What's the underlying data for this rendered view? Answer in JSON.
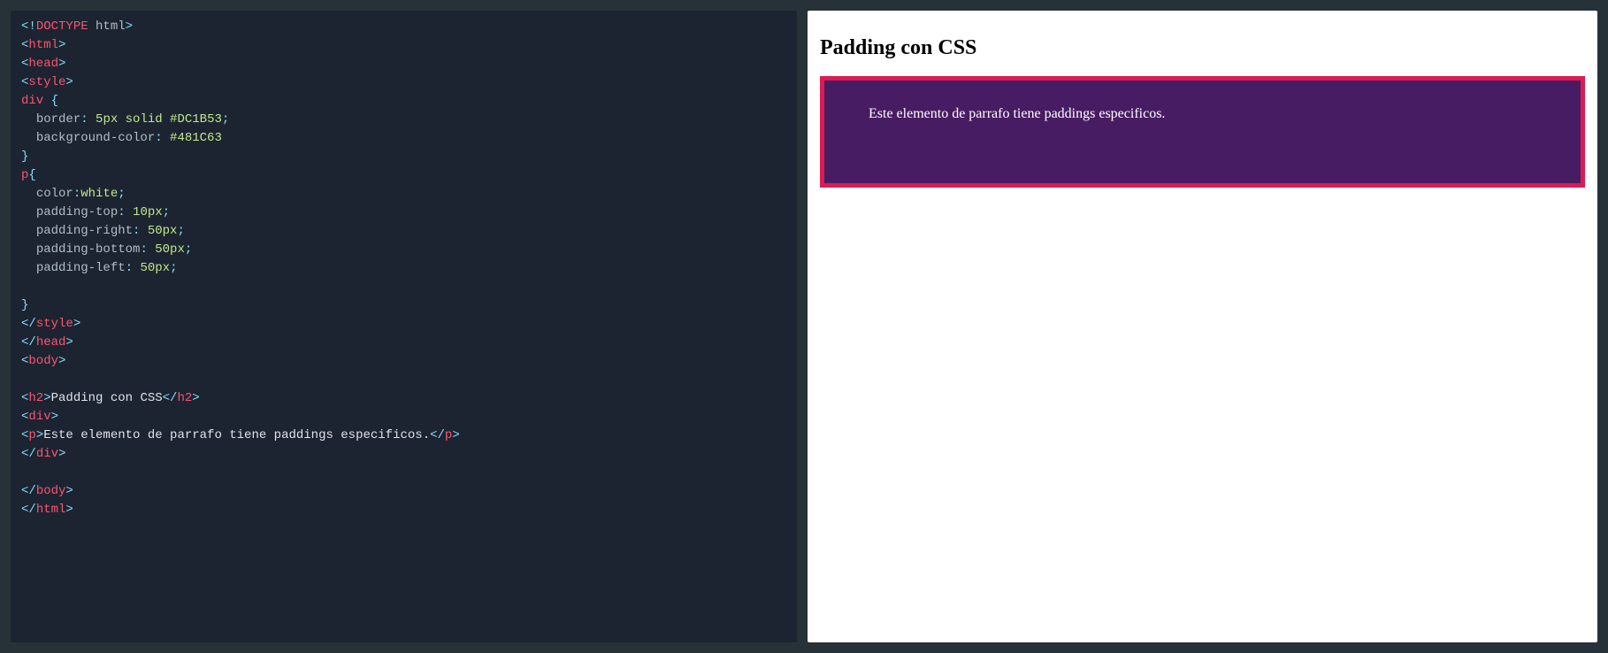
{
  "preview": {
    "heading": "Padding con CSS",
    "paragraph": "Este elemento de parrafo tiene paddings especificos.",
    "colors": {
      "border": "#DC1B53",
      "background": "#481C63",
      "text": "white"
    }
  },
  "tokens": [
    [
      {
        "cls": "tok-punc",
        "t": "<!"
      },
      {
        "cls": "tok-doctype",
        "t": "DOCTYPE"
      },
      {
        "cls": "tok-docval",
        "t": " html"
      },
      {
        "cls": "tok-punc",
        "t": ">"
      }
    ],
    [
      {
        "cls": "tok-punc",
        "t": "<"
      },
      {
        "cls": "tok-tag",
        "t": "html"
      },
      {
        "cls": "tok-punc",
        "t": ">"
      }
    ],
    [
      {
        "cls": "tok-punc",
        "t": "<"
      },
      {
        "cls": "tok-tag",
        "t": "head"
      },
      {
        "cls": "tok-punc",
        "t": ">"
      }
    ],
    [
      {
        "cls": "tok-punc",
        "t": "<"
      },
      {
        "cls": "tok-tag",
        "t": "style"
      },
      {
        "cls": "tok-punc",
        "t": ">"
      }
    ],
    [
      {
        "cls": "tok-sel",
        "t": "div"
      },
      {
        "cls": "tok-text",
        "t": " "
      },
      {
        "cls": "tok-punc",
        "t": "{"
      }
    ],
    [
      {
        "cls": "tok-text",
        "t": "  "
      },
      {
        "cls": "tok-prop",
        "t": "border"
      },
      {
        "cls": "tok-punc",
        "t": ": "
      },
      {
        "cls": "tok-val",
        "t": "5px solid #DC1B53"
      },
      {
        "cls": "tok-punc",
        "t": ";"
      }
    ],
    [
      {
        "cls": "tok-text",
        "t": "  "
      },
      {
        "cls": "tok-prop",
        "t": "background-color"
      },
      {
        "cls": "tok-punc",
        "t": ": "
      },
      {
        "cls": "tok-val",
        "t": "#481C63"
      }
    ],
    [
      {
        "cls": "tok-punc",
        "t": "}"
      }
    ],
    [
      {
        "cls": "tok-sel",
        "t": "p"
      },
      {
        "cls": "tok-punc",
        "t": "{"
      }
    ],
    [
      {
        "cls": "tok-text",
        "t": "  "
      },
      {
        "cls": "tok-prop",
        "t": "color"
      },
      {
        "cls": "tok-punc",
        "t": ":"
      },
      {
        "cls": "tok-val",
        "t": "white"
      },
      {
        "cls": "tok-punc",
        "t": ";"
      }
    ],
    [
      {
        "cls": "tok-text",
        "t": "  "
      },
      {
        "cls": "tok-prop",
        "t": "padding-top"
      },
      {
        "cls": "tok-punc",
        "t": ": "
      },
      {
        "cls": "tok-val",
        "t": "10px"
      },
      {
        "cls": "tok-punc",
        "t": ";"
      }
    ],
    [
      {
        "cls": "tok-text",
        "t": "  "
      },
      {
        "cls": "tok-prop",
        "t": "padding-right"
      },
      {
        "cls": "tok-punc",
        "t": ": "
      },
      {
        "cls": "tok-val",
        "t": "50px"
      },
      {
        "cls": "tok-punc",
        "t": ";"
      }
    ],
    [
      {
        "cls": "tok-text",
        "t": "  "
      },
      {
        "cls": "tok-prop",
        "t": "padding-bottom"
      },
      {
        "cls": "tok-punc",
        "t": ": "
      },
      {
        "cls": "tok-val",
        "t": "50px"
      },
      {
        "cls": "tok-punc",
        "t": ";"
      }
    ],
    [
      {
        "cls": "tok-text",
        "t": "  "
      },
      {
        "cls": "tok-prop",
        "t": "padding-left"
      },
      {
        "cls": "tok-punc",
        "t": ": "
      },
      {
        "cls": "tok-val",
        "t": "50px"
      },
      {
        "cls": "tok-punc",
        "t": ";"
      }
    ],
    [
      {
        "cls": "tok-text",
        "t": ""
      }
    ],
    [
      {
        "cls": "tok-punc",
        "t": "}"
      }
    ],
    [
      {
        "cls": "tok-punc",
        "t": "</"
      },
      {
        "cls": "tok-tag",
        "t": "style"
      },
      {
        "cls": "tok-punc",
        "t": ">"
      }
    ],
    [
      {
        "cls": "tok-punc",
        "t": "</"
      },
      {
        "cls": "tok-tag",
        "t": "head"
      },
      {
        "cls": "tok-punc",
        "t": ">"
      }
    ],
    [
      {
        "cls": "tok-punc",
        "t": "<"
      },
      {
        "cls": "tok-tag",
        "t": "body"
      },
      {
        "cls": "tok-punc",
        "t": ">"
      }
    ],
    [
      {
        "cls": "tok-text",
        "t": ""
      }
    ],
    [
      {
        "cls": "tok-punc",
        "t": "<"
      },
      {
        "cls": "tok-tag",
        "t": "h2"
      },
      {
        "cls": "tok-punc",
        "t": ">"
      },
      {
        "cls": "tok-text",
        "t": "Padding con CSS"
      },
      {
        "cls": "tok-punc",
        "t": "</"
      },
      {
        "cls": "tok-tag",
        "t": "h2"
      },
      {
        "cls": "tok-punc",
        "t": ">"
      }
    ],
    [
      {
        "cls": "tok-punc",
        "t": "<"
      },
      {
        "cls": "tok-tag",
        "t": "div"
      },
      {
        "cls": "tok-punc",
        "t": ">"
      }
    ],
    [
      {
        "cls": "tok-punc",
        "t": "<"
      },
      {
        "cls": "tok-tag",
        "t": "p"
      },
      {
        "cls": "tok-punc",
        "t": ">"
      },
      {
        "cls": "tok-text",
        "t": "Este elemento de parrafo tiene paddings especificos."
      },
      {
        "cls": "tok-punc",
        "t": "</"
      },
      {
        "cls": "tok-tag",
        "t": "p"
      },
      {
        "cls": "tok-punc",
        "t": ">"
      }
    ],
    [
      {
        "cls": "tok-punc",
        "t": "</"
      },
      {
        "cls": "tok-tag",
        "t": "div"
      },
      {
        "cls": "tok-punc",
        "t": ">"
      }
    ],
    [
      {
        "cls": "tok-text",
        "t": ""
      }
    ],
    [
      {
        "cls": "tok-punc",
        "t": "</"
      },
      {
        "cls": "tok-tag",
        "t": "body"
      },
      {
        "cls": "tok-punc",
        "t": ">"
      }
    ],
    [
      {
        "cls": "tok-punc",
        "t": "</"
      },
      {
        "cls": "tok-tag",
        "t": "html"
      },
      {
        "cls": "tok-punc",
        "t": ">"
      }
    ]
  ]
}
